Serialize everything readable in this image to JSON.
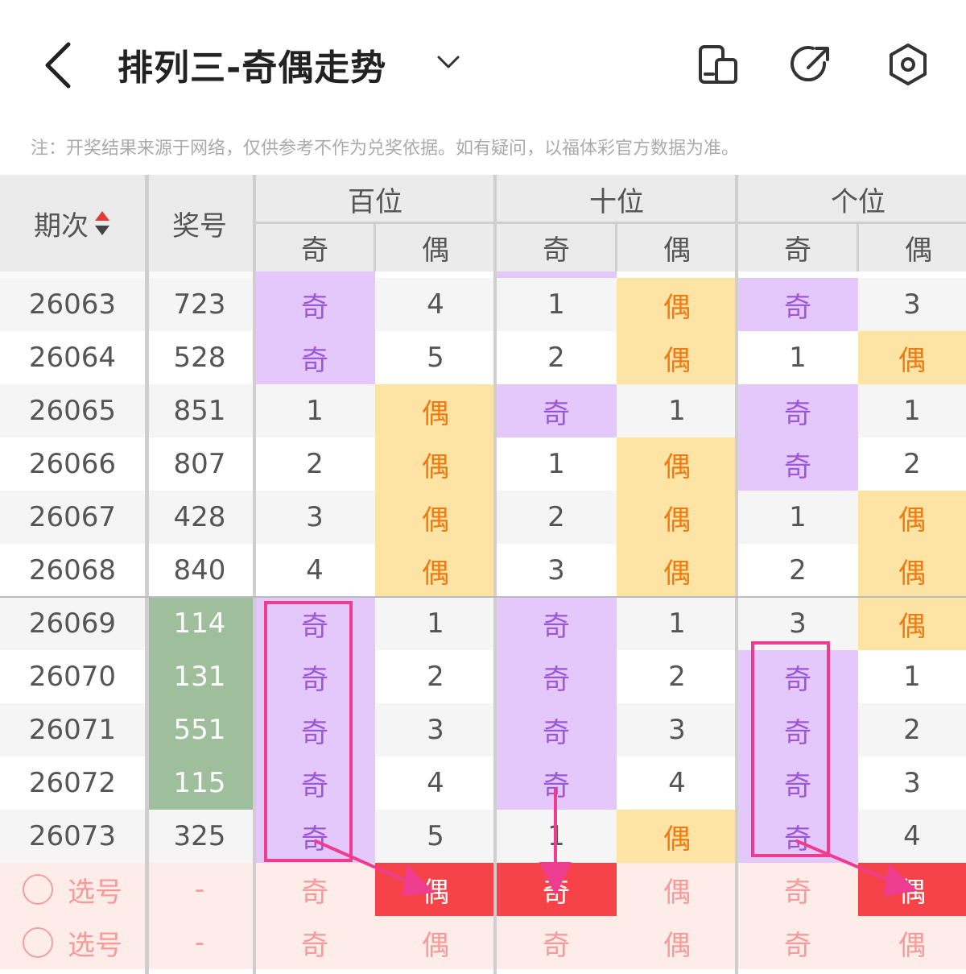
{
  "header": {
    "title": "排列三-奇偶走势"
  },
  "note": "注：开奖结果来源于网络，仅供参考不作为兑奖依据。如有疑问，以福体彩官方数据为准。",
  "table": {
    "col_issue": "期次",
    "col_number": "奖号",
    "groups": [
      "百位",
      "十位",
      "个位"
    ],
    "sub_odd": "奇",
    "sub_even": "偶",
    "rows": [
      {
        "issue": "26063",
        "number": "723",
        "cells": [
          "奇",
          "4",
          "1",
          "偶",
          "奇",
          "3"
        ]
      },
      {
        "issue": "26064",
        "number": "528",
        "cells": [
          "奇",
          "5",
          "2",
          "偶",
          "1",
          "偶"
        ]
      },
      {
        "issue": "26065",
        "number": "851",
        "cells": [
          "1",
          "偶",
          "奇",
          "1",
          "奇",
          "1"
        ]
      },
      {
        "issue": "26066",
        "number": "807",
        "cells": [
          "2",
          "偶",
          "1",
          "偶",
          "奇",
          "2"
        ]
      },
      {
        "issue": "26067",
        "number": "428",
        "cells": [
          "3",
          "偶",
          "2",
          "偶",
          "1",
          "偶"
        ]
      },
      {
        "issue": "26068",
        "number": "840",
        "cells": [
          "4",
          "偶",
          "3",
          "偶",
          "2",
          "偶"
        ]
      },
      {
        "issue": "26069",
        "number": "114",
        "cells": [
          "奇",
          "1",
          "奇",
          "1",
          "3",
          "偶"
        ]
      },
      {
        "issue": "26070",
        "number": "131",
        "cells": [
          "奇",
          "2",
          "奇",
          "2",
          "奇",
          "1"
        ]
      },
      {
        "issue": "26071",
        "number": "551",
        "cells": [
          "奇",
          "3",
          "奇",
          "3",
          "奇",
          "2"
        ]
      },
      {
        "issue": "26072",
        "number": "115",
        "cells": [
          "奇",
          "4",
          "奇",
          "4",
          "奇",
          "3"
        ]
      },
      {
        "issue": "26073",
        "number": "325",
        "cells": [
          "奇",
          "5",
          "1",
          "偶",
          "奇",
          "4"
        ]
      }
    ],
    "select_rows": [
      {
        "label": "选号",
        "number": "-",
        "cells": [
          "奇",
          "偶",
          "奇",
          "偶",
          "奇",
          "偶"
        ]
      },
      {
        "label": "选号",
        "number": "-",
        "cells": [
          "奇",
          "偶",
          "奇",
          "偶",
          "奇",
          "偶"
        ]
      }
    ]
  },
  "colors": {
    "odd_bg": "#e4c8fb",
    "even_bg": "#fde3a4",
    "green_bg": "#9fbe9c",
    "select_bg": "#fdece8",
    "highlight_red": "#f6434a",
    "annotation_pink": "#ee3d8e"
  }
}
